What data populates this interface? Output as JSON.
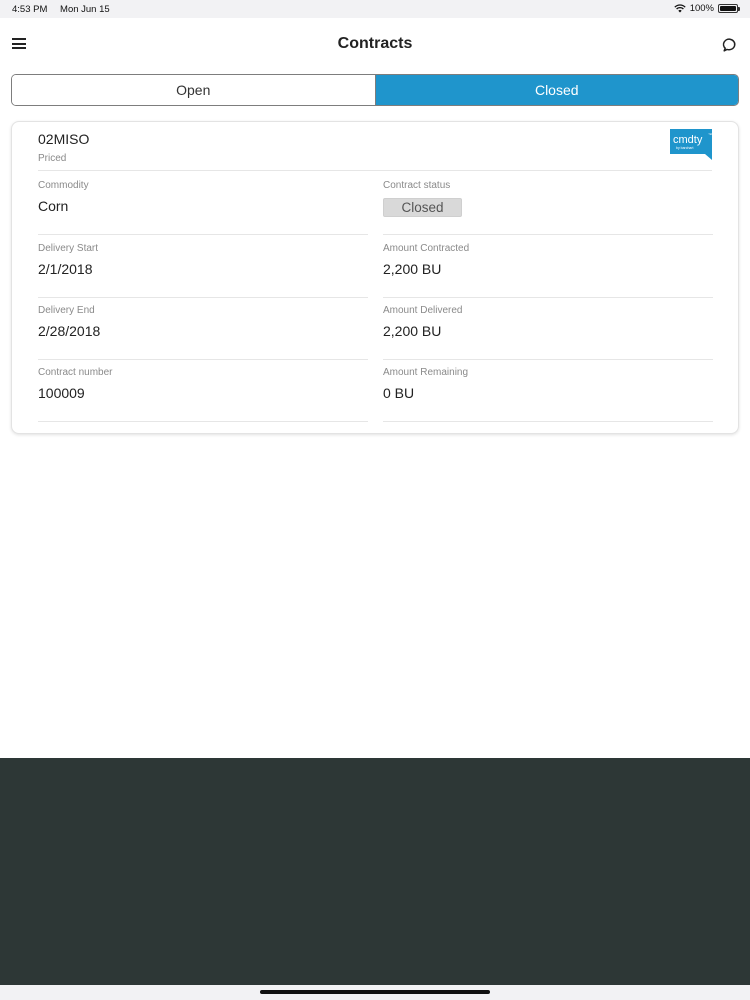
{
  "status_bar": {
    "time": "4:53 PM",
    "date": "Mon Jun 15",
    "battery": "100%",
    "battery_level": 1.0
  },
  "header": {
    "title": "Contracts",
    "menu_icon": "hamburger-menu-icon",
    "chat_icon": "chat-bubble-icon"
  },
  "tabs": [
    {
      "label": "Open",
      "active": false
    },
    {
      "label": "Closed",
      "active": true
    }
  ],
  "colors": {
    "accent": "#1f95cc",
    "bottom_panel": "#2d3736",
    "logo_bg": "#1f95cc"
  },
  "contract": {
    "id": "02MISO",
    "type": "Priced",
    "logo": {
      "name": "cmdty",
      "sub": "by barchart"
    },
    "fields": {
      "commodity": {
        "label": "Commodity",
        "value": "Corn"
      },
      "status": {
        "label": "Contract status",
        "value": "Closed"
      },
      "delivery_start": {
        "label": "Delivery Start",
        "value": "2/1/2018"
      },
      "amount_contracted": {
        "label": "Amount Contracted",
        "value": "2,200 BU"
      },
      "delivery_end": {
        "label": "Delivery End",
        "value": "2/28/2018"
      },
      "amount_delivered": {
        "label": "Amount Delivered",
        "value": "2,200 BU"
      },
      "contract_number": {
        "label": "Contract number",
        "value": "100009"
      },
      "amount_remaining": {
        "label": "Amount Remaining",
        "value": "0 BU"
      }
    }
  }
}
